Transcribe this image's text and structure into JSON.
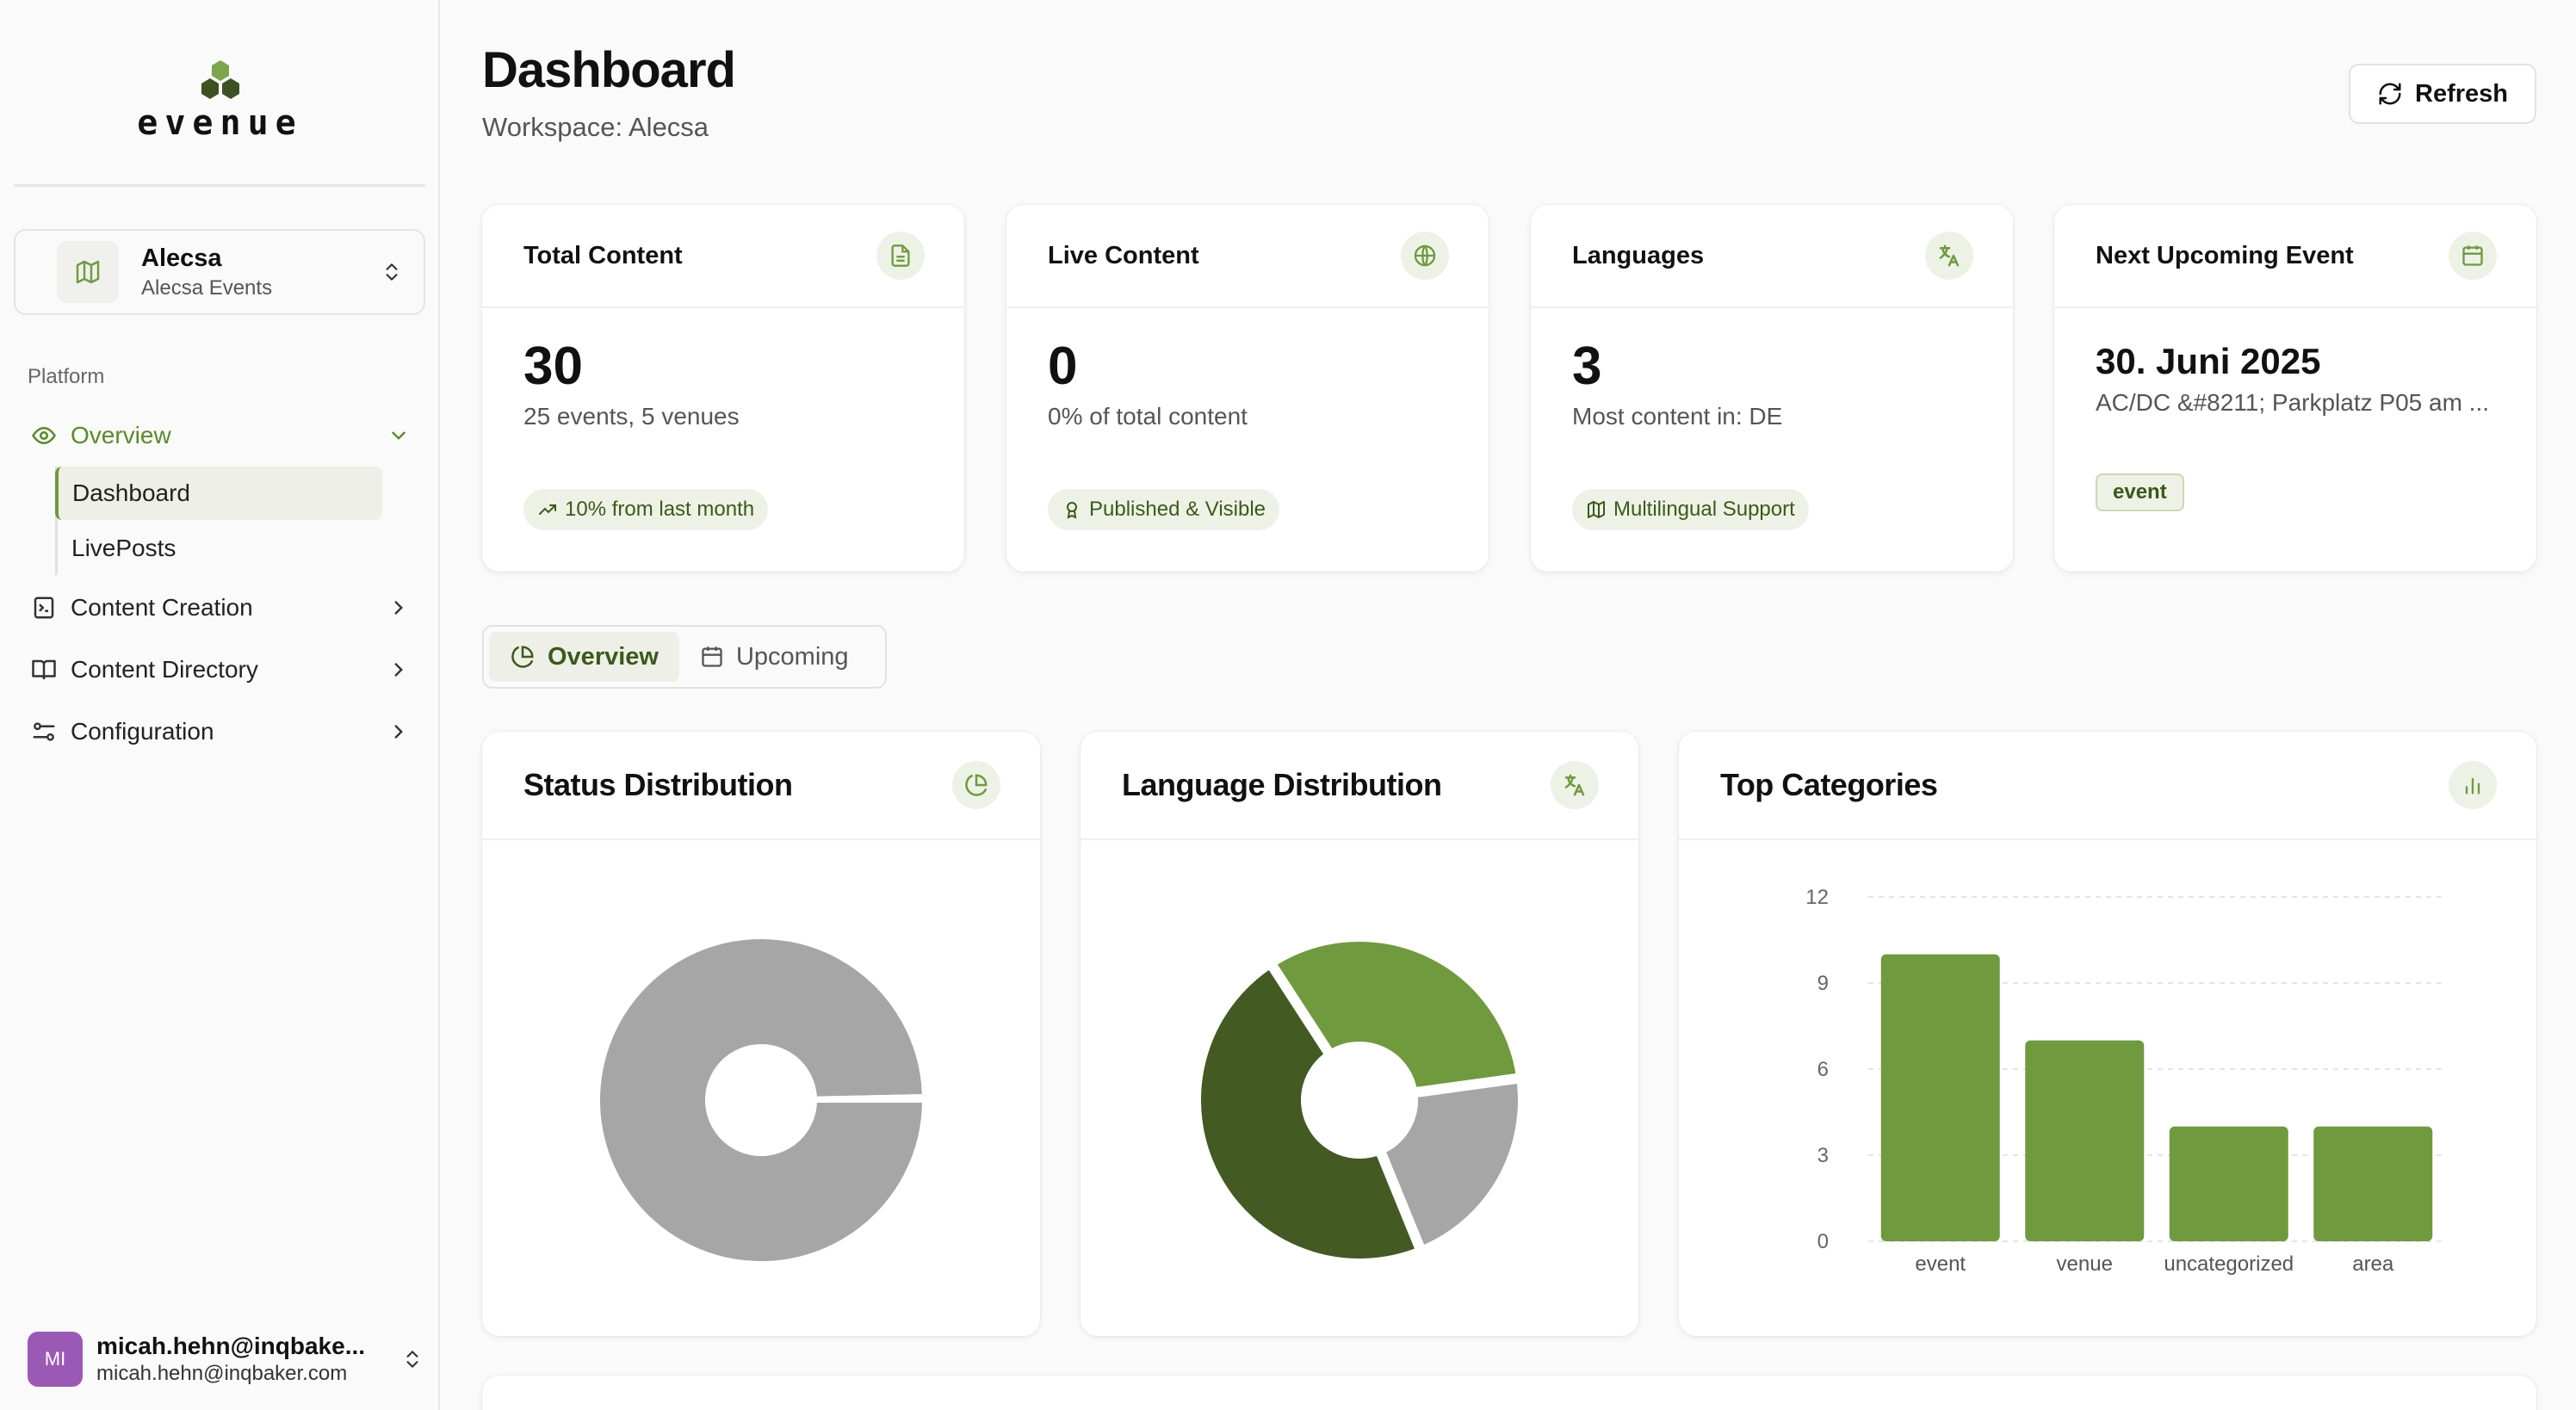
{
  "app": {
    "brand": "evenue"
  },
  "workspace_switcher": {
    "name": "Alecsa",
    "subtitle": "Alecsa Events"
  },
  "sidebar": {
    "section_label": "Platform",
    "items": [
      {
        "label": "Overview",
        "icon": "eye-icon",
        "expanded": true,
        "children": [
          {
            "label": "Dashboard",
            "active": true
          },
          {
            "label": "LivePosts",
            "active": false
          }
        ]
      },
      {
        "label": "Content Creation",
        "icon": "file-code-icon"
      },
      {
        "label": "Content Directory",
        "icon": "book-open-icon"
      },
      {
        "label": "Configuration",
        "icon": "sliders-icon"
      }
    ]
  },
  "user": {
    "initials": "MI",
    "name": "micah.hehn@inqbake...",
    "email": "micah.hehn@inqbaker.com"
  },
  "header": {
    "title": "Dashboard",
    "subtitle": "Workspace: Alecsa",
    "refresh_label": "Refresh"
  },
  "stats": [
    {
      "title": "Total Content",
      "icon": "file-text-icon",
      "value": "30",
      "desc": "25 events, 5 venues",
      "badge": "10% from last month",
      "badge_icon": "trending-up-icon"
    },
    {
      "title": "Live Content",
      "icon": "globe-icon",
      "value": "0",
      "desc": "0% of total content",
      "badge": "Published & Visible",
      "badge_icon": "award-icon"
    },
    {
      "title": "Languages",
      "icon": "languages-icon",
      "value": "3",
      "desc": "Most content in: DE",
      "badge": "Multilingual Support",
      "badge_icon": "map-icon"
    },
    {
      "title": "Next Upcoming Event",
      "icon": "calendar-icon",
      "value": "30. Juni 2025",
      "desc": "AC/DC &#8211; Parkplatz P05 am ...",
      "badge": "event"
    }
  ],
  "tabs": [
    {
      "label": "Overview",
      "icon": "pie-chart-icon",
      "active": true
    },
    {
      "label": "Upcoming",
      "icon": "calendar-icon",
      "active": false
    }
  ],
  "panels": {
    "status": {
      "title": "Status Distribution",
      "icon": "pie-chart-icon"
    },
    "language": {
      "title": "Language Distribution",
      "icon": "languages-icon"
    },
    "categories": {
      "title": "Top Categories",
      "icon": "bar-chart-icon"
    }
  },
  "colors": {
    "accent": "#6f9a3e",
    "dark_green": "#435a23",
    "grey": "#a6a6a6"
  },
  "chart_data": [
    {
      "type": "pie",
      "title": "Status Distribution",
      "slices": [
        {
          "value": 29.9,
          "color": "#a6a6a6"
        },
        {
          "value": 0.1,
          "color": "#6f9a3e"
        }
      ]
    },
    {
      "type": "pie",
      "title": "Language Distribution",
      "slices": [
        {
          "value": 32,
          "color": "#6f9a3e"
        },
        {
          "value": 21,
          "color": "#a6a6a6"
        },
        {
          "value": 47,
          "color": "#435a23"
        }
      ]
    },
    {
      "type": "bar",
      "title": "Top Categories",
      "categories": [
        "event",
        "venue",
        "uncategorized",
        "area"
      ],
      "values": [
        10,
        7,
        4,
        4
      ],
      "ylim": [
        0,
        12
      ],
      "yticks": [
        0,
        3,
        6,
        9,
        12
      ],
      "grid": true,
      "color": "#6f9a3e"
    }
  ]
}
